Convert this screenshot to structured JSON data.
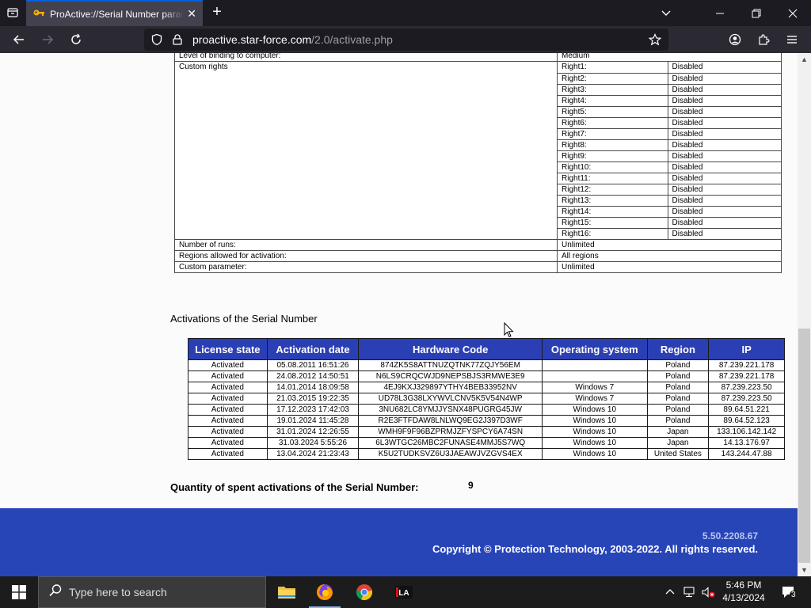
{
  "browser": {
    "tab_title": "ProActive://Serial Number paran",
    "url_domain": "proactive.star-force.com",
    "url_path": "/2.0/activate.php"
  },
  "details": {
    "binding_label": "Level of binding to computer:",
    "binding_value": "Medium",
    "custom_rights_label": "Custom rights",
    "rights": [
      {
        "name": "Right1:",
        "value": "Disabled"
      },
      {
        "name": "Right2:",
        "value": "Disabled"
      },
      {
        "name": "Right3:",
        "value": "Disabled"
      },
      {
        "name": "Right4:",
        "value": "Disabled"
      },
      {
        "name": "Right5:",
        "value": "Disabled"
      },
      {
        "name": "Right6:",
        "value": "Disabled"
      },
      {
        "name": "Right7:",
        "value": "Disabled"
      },
      {
        "name": "Right8:",
        "value": "Disabled"
      },
      {
        "name": "Right9:",
        "value": "Disabled"
      },
      {
        "name": "Right10:",
        "value": "Disabled"
      },
      {
        "name": "Right11:",
        "value": "Disabled"
      },
      {
        "name": "Right12:",
        "value": "Disabled"
      },
      {
        "name": "Right13:",
        "value": "Disabled"
      },
      {
        "name": "Right14:",
        "value": "Disabled"
      },
      {
        "name": "Right15:",
        "value": "Disabled"
      },
      {
        "name": "Right16:",
        "value": "Disabled"
      }
    ],
    "runs_label": "Number of runs:",
    "runs_value": "Unlimited",
    "regions_label": "Regions allowed for activation:",
    "regions_value": "All regions",
    "custom_param_label": "Custom parameter:",
    "custom_param_value": "Unlimited"
  },
  "activations": {
    "heading": "Activations of the Serial Number",
    "columns": [
      "License state",
      "Activation date",
      "Hardware Code",
      "Operating system",
      "Region",
      "IP"
    ],
    "rows": [
      [
        "Activated",
        "05.08.2011 16:51:26",
        "874ZK5S8ATTNUZQTNK77ZQJY56EM",
        "",
        "Poland",
        "87.239.221.178"
      ],
      [
        "Activated",
        "24.08.2012 14:50:51",
        "N6LS9CRQCWJD9NEPSBJS3RMWE3E9",
        "",
        "Poland",
        "87.239.221.178"
      ],
      [
        "Activated",
        "14.01.2014 18:09:58",
        "4EJ9KXJ329897YTHY4BEB33952NV",
        "Windows 7",
        "Poland",
        "87.239.223.50"
      ],
      [
        "Activated",
        "21.03.2015 19:22:35",
        "UD78L3G38LXYWVLCNV5K5V54N4WP",
        "Windows 7",
        "Poland",
        "87.239.223.50"
      ],
      [
        "Activated",
        "17.12.2023 17:42:03",
        "3NU682LC8YMJJYSNX48PUGRG45JW",
        "Windows 10",
        "Poland",
        "89.64.51.221"
      ],
      [
        "Activated",
        "19.01.2024 11:45:28",
        "R2E3FTFDAW8LNLWQ9EG2J397D3WF",
        "Windows 10",
        "Poland",
        "89.64.52.123"
      ],
      [
        "Activated",
        "31.01.2024 12:26:55",
        "WMH9F9F96BZPRMJZFYSPCY6A74SN",
        "Windows 10",
        "Japan",
        "133.106.142.142"
      ],
      [
        "Activated",
        "31.03.2024 5:55:26",
        "6L3WTGC26MBC2FUNASE4MMJ5S7WQ",
        "Windows 10",
        "Japan",
        "14.13.176.97"
      ],
      [
        "Activated",
        "13.04.2024 21:23:43",
        "K5U2TUDKSVZ6U3JAEAWJVZGVS4EX",
        "Windows 10",
        "United States",
        "143.244.47.88"
      ]
    ],
    "quantity_label": "Quantity of spent activations of the Serial Number:",
    "quantity_value": "9"
  },
  "footer": {
    "version": "5.50.2208.67",
    "copyright": "Copyright © Protection Technology, 2003-2022. All rights reserved."
  },
  "taskbar": {
    "search_placeholder": "Type here to search",
    "time": "5:46 PM",
    "date": "4/13/2024",
    "notification_count": "3"
  },
  "colors": {
    "table_header": "#2b3fb4",
    "footer": "#2845b8",
    "browser_tab_active": "#42414d"
  }
}
